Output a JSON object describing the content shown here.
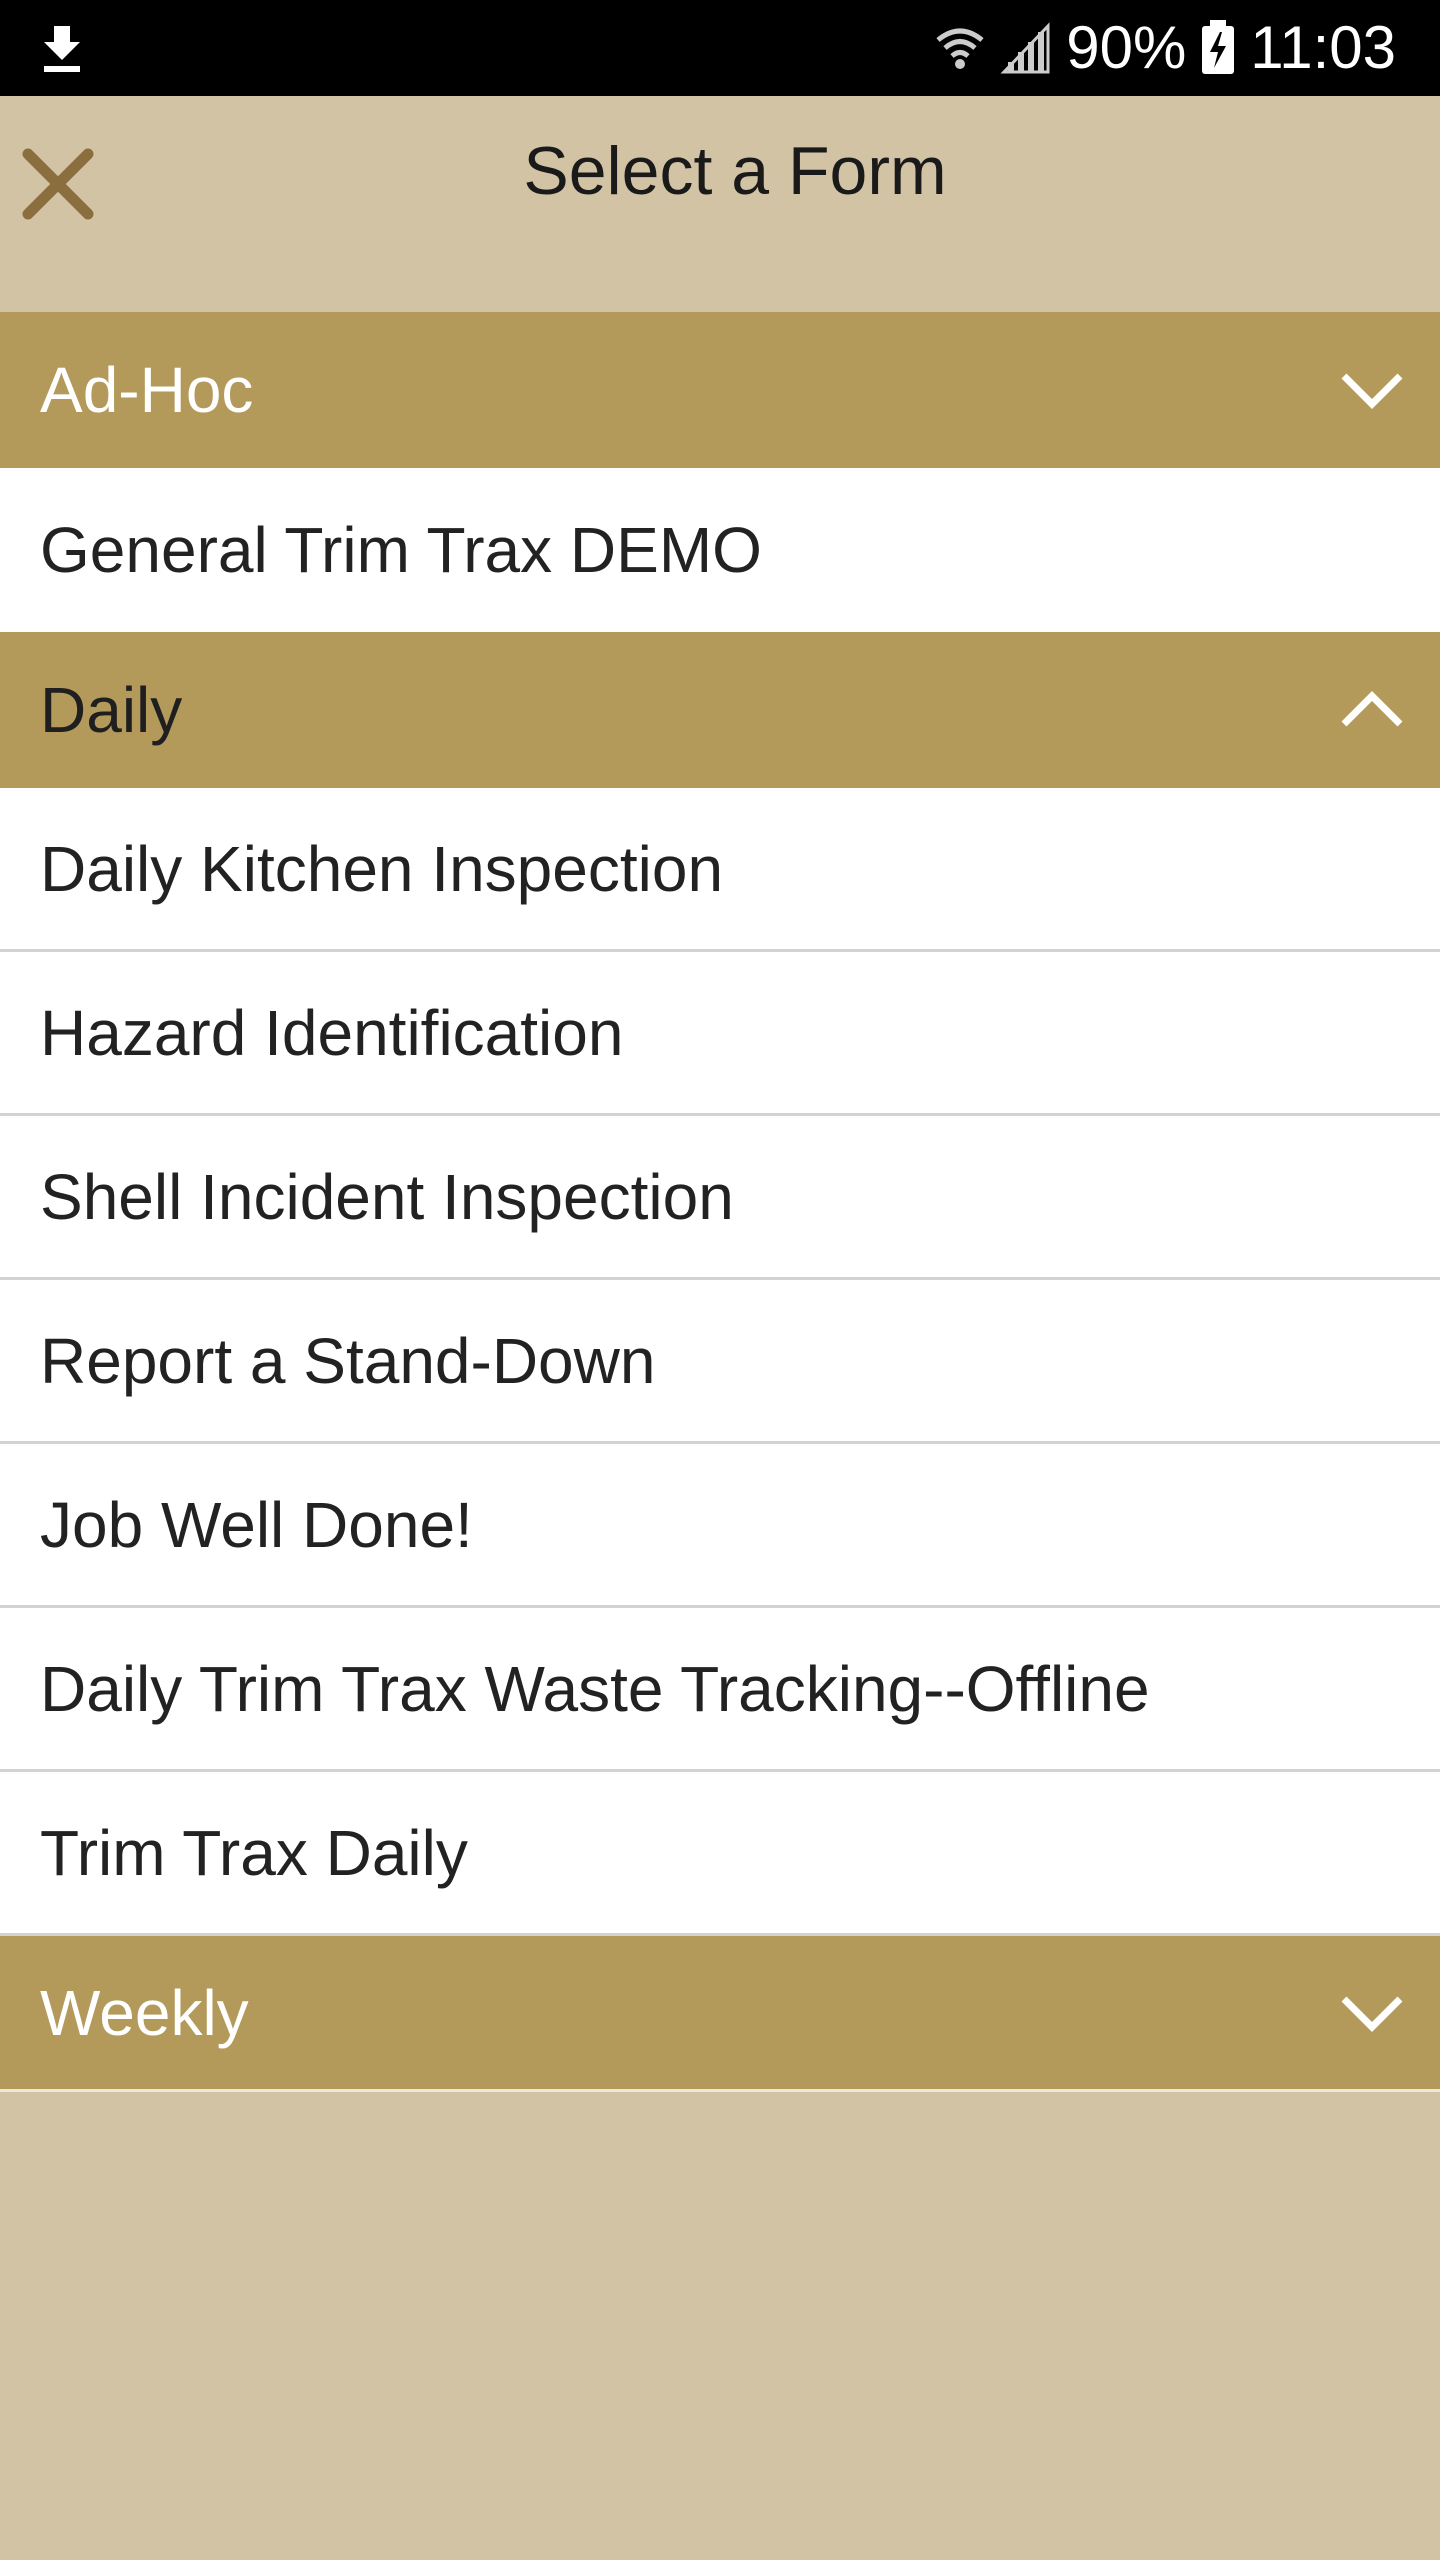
{
  "status_bar": {
    "battery": "90%",
    "time": "11:03",
    "icons": [
      "download-icon",
      "wifi-icon",
      "signal-icon",
      "battery-charging-icon"
    ]
  },
  "app_bar": {
    "title": "Select a Form",
    "close_icon": "close-icon"
  },
  "colors": {
    "background": "#d3c3a5",
    "group_header": "#b39a5b",
    "close_icon": "#8a6e3e",
    "item_background": "#ffffff"
  },
  "groups": [
    {
      "label": "Ad-Hoc",
      "expanded": false,
      "items": [
        "General Trim Trax DEMO"
      ]
    },
    {
      "label": "Daily",
      "expanded": true,
      "items": [
        "Daily Kitchen Inspection",
        "Hazard Identification",
        "Shell Incident Inspection",
        "Report a Stand-Down",
        "Job Well Done!",
        "Daily Trim Trax Waste Tracking--Offline",
        "Trim Trax Daily"
      ]
    },
    {
      "label": "Weekly",
      "expanded": false,
      "items": []
    }
  ]
}
